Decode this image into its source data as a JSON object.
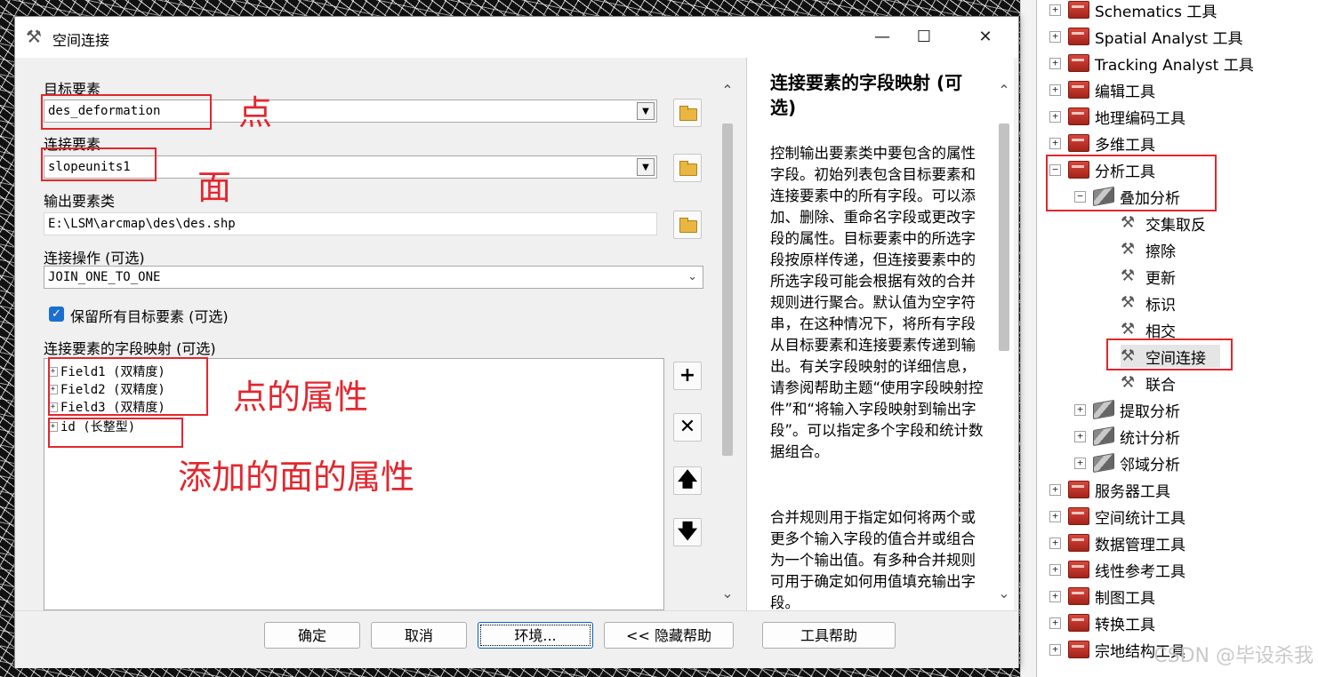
{
  "dialog": {
    "title": "空间连接",
    "close_glyph": "✕",
    "target_features_label": "目标要素",
    "target_features_value": "des_deformation",
    "join_features_label": "连接要素",
    "join_features_value": "slopeunits1",
    "output_label": "输出要素类",
    "output_value": "E:\\LSM\\arcmap\\des\\des.shp",
    "join_operation_label": "连接操作 (可选)",
    "join_operation_value": "JOIN_ONE_TO_ONE",
    "keep_all_label": "保留所有目标要素 (可选)",
    "keep_all_checked": true,
    "field_map_label": "连接要素的字段映射 (可选)",
    "fields": [
      {
        "name": "Field1 (双精度)"
      },
      {
        "name": "Field2 (双精度)"
      },
      {
        "name": "Field3 (双精度)"
      },
      {
        "name": "id (长整型)"
      }
    ],
    "buttons": {
      "ok": "确定",
      "cancel": "取消",
      "environments": "环境...",
      "hide_help": "<< 隐藏帮助",
      "tool_help": "工具帮助"
    },
    "help": {
      "title": "连接要素的字段映射 (可选)",
      "paragraph1": "控制输出要素类中要包含的属性字段。初始列表包含目标要素和连接要素中的所有字段。可以添加、删除、重命名字段或更改字段的属性。目标要素中的所选字段按原样传递，但连接要素中的所选字段可能会根据有效的合并规则进行聚合。默认值为空字符串，在这种情况下，将所有字段从目标要素和连接要素传递到输出。有关字段映射的详细信息，请参阅帮助主题“使用字段映射控件”和“将输入字段映射到输出字段”。可以指定多个字段和统计数据组合。",
      "paragraph2": "合并规则用于指定如何将两个或更多个输入字段的值合并或组合为一个输出值。有多种合并规则可用于确定如何用值填充输出字段。"
    }
  },
  "annotations": {
    "point": "点",
    "polygon": "面",
    "point_attributes": "点的属性",
    "added_polygon_attributes": "添加的面的属性"
  },
  "toolbox": {
    "items": [
      {
        "label": "Schematics 工具"
      },
      {
        "label": "Spatial Analyst 工具"
      },
      {
        "label": "Tracking Analyst 工具"
      },
      {
        "label": "编辑工具"
      },
      {
        "label": "地理编码工具"
      },
      {
        "label": "多维工具"
      },
      {
        "label": "分析工具"
      },
      {
        "label": "叠加分析"
      },
      {
        "label": "交集取反"
      },
      {
        "label": "擦除"
      },
      {
        "label": "更新"
      },
      {
        "label": "标识"
      },
      {
        "label": "相交"
      },
      {
        "label": "空间连接"
      },
      {
        "label": "联合"
      },
      {
        "label": "提取分析"
      },
      {
        "label": "统计分析"
      },
      {
        "label": "邻域分析"
      },
      {
        "label": "服务器工具"
      },
      {
        "label": "空间统计工具"
      },
      {
        "label": "数据管理工具"
      },
      {
        "label": "线性参考工具"
      },
      {
        "label": "制图工具"
      },
      {
        "label": "转换工具"
      },
      {
        "label": "宗地结构工具"
      }
    ]
  },
  "watermark": "CSDN @毕设杀我"
}
